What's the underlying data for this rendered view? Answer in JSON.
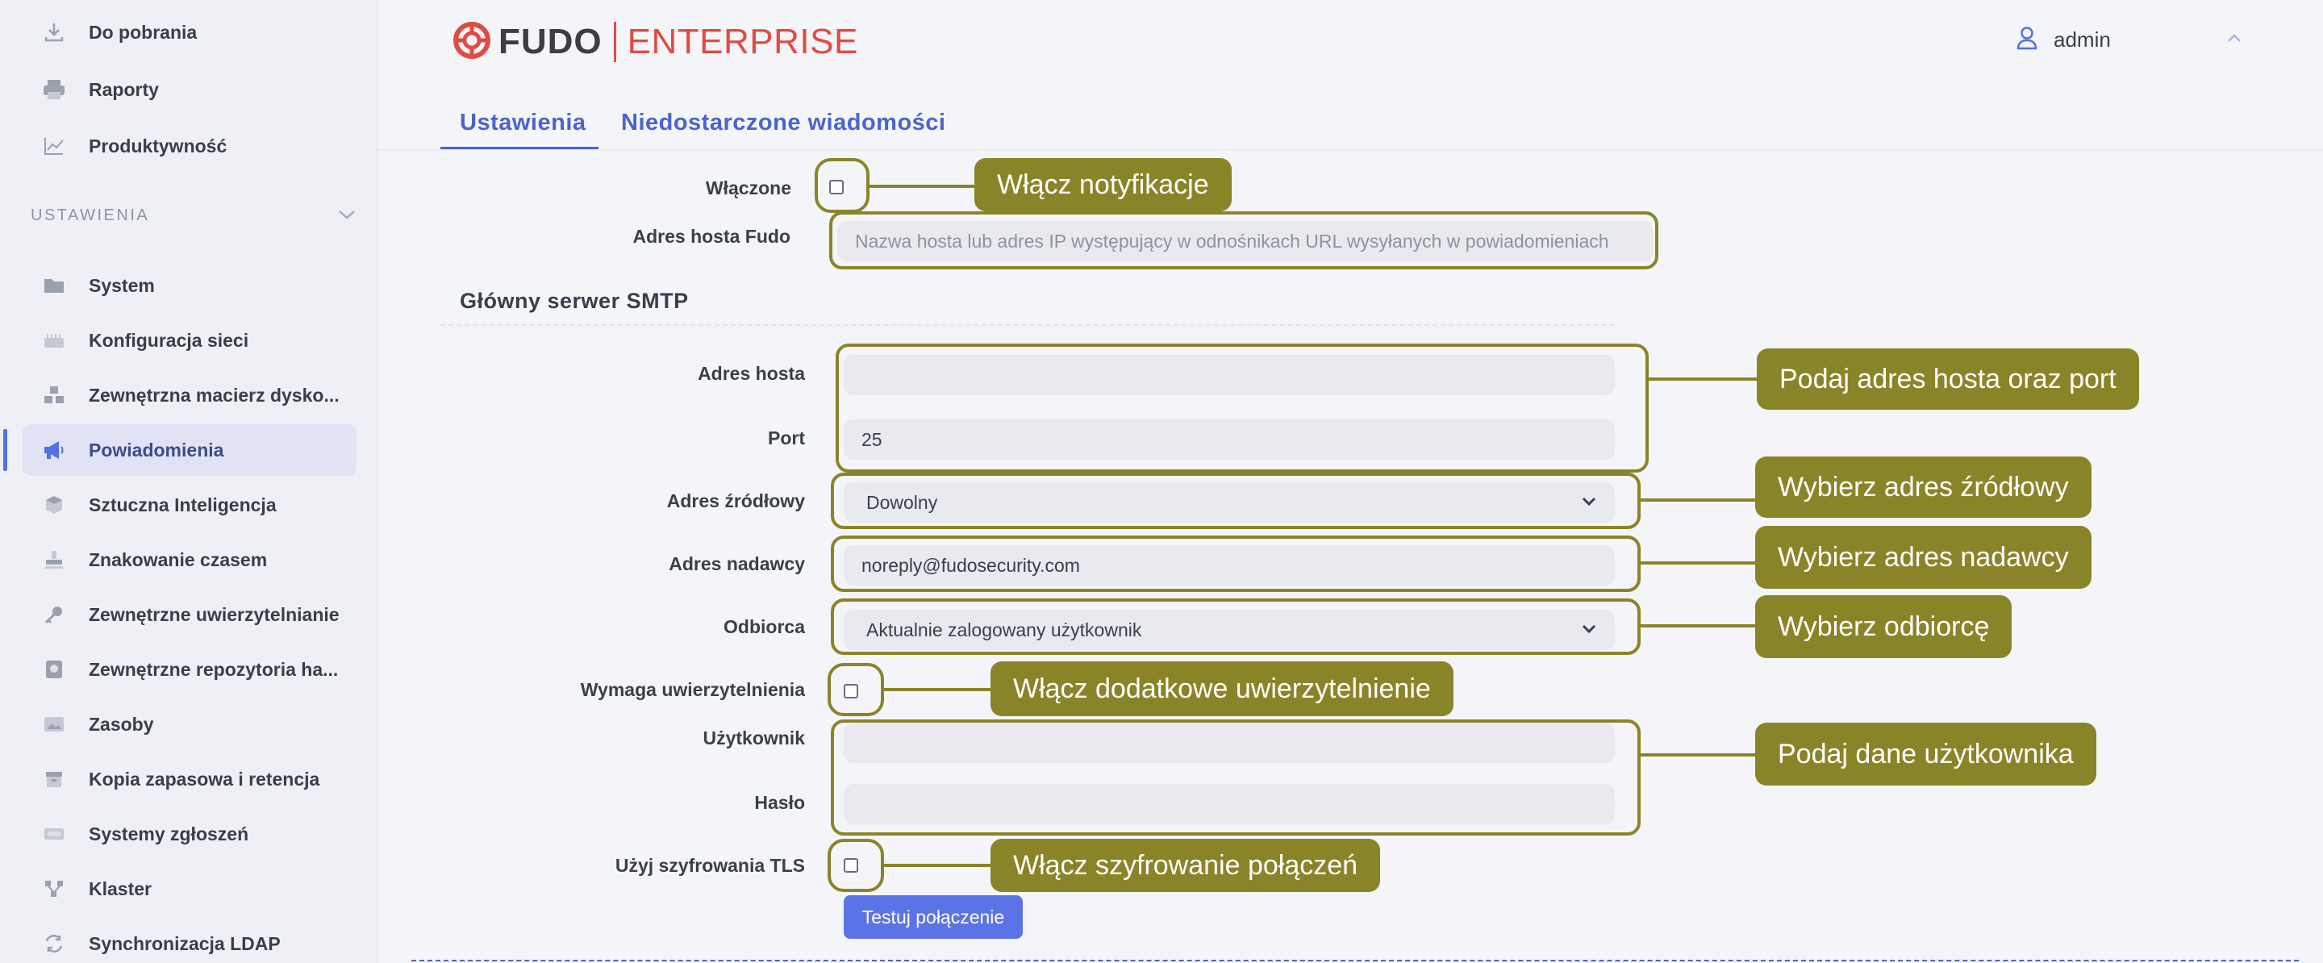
{
  "sidebar": {
    "items_top": [
      {
        "label": "Do pobrania",
        "icon": "download-icon"
      },
      {
        "label": "Raporty",
        "icon": "printer-icon"
      },
      {
        "label": "Produktywność",
        "icon": "chart-line-icon"
      }
    ],
    "section_label": "USTAWIENIA",
    "items": [
      {
        "label": "System",
        "icon": "folder-icon"
      },
      {
        "label": "Konfiguracja sieci",
        "icon": "network-icon"
      },
      {
        "label": "Zewnętrzna macierz dysko...",
        "icon": "storage-icon"
      },
      {
        "label": "Powiadomienia",
        "icon": "megaphone-icon",
        "active": true
      },
      {
        "label": "Sztuczna Inteligencja",
        "icon": "ai-cube-icon"
      },
      {
        "label": "Znakowanie czasem",
        "icon": "stamp-icon"
      },
      {
        "label": "Zewnętrzne uwierzytelnianie",
        "icon": "key-icon"
      },
      {
        "label": "Zewnętrzne repozytoria ha...",
        "icon": "vault-icon"
      },
      {
        "label": "Zasoby",
        "icon": "image-icon"
      },
      {
        "label": "Kopia zapasowa i retencja",
        "icon": "archive-icon"
      },
      {
        "label": "Systemy zgłoszeń",
        "icon": "ticket-icon"
      },
      {
        "label": "Klaster",
        "icon": "cluster-icon"
      },
      {
        "label": "Synchronizacja LDAP",
        "icon": "sync-icon"
      }
    ]
  },
  "header": {
    "logo_fudo": "FUDO",
    "logo_enterprise": "ENTERPRISE",
    "user_name": "admin"
  },
  "tabs": [
    {
      "label": "Ustawienia",
      "active": true
    },
    {
      "label": "Niedostarczone wiadomości",
      "active": false
    }
  ],
  "form": {
    "enabled_label": "Włączone",
    "fudo_host_label": "Adres hosta Fudo",
    "fudo_host_placeholder": "Nazwa hosta lub adres IP występujący w odnośnikach URL wysyłanych w powiadomieniach",
    "smtp_section": "Główny serwer SMTP",
    "host_label": "Adres hosta",
    "host_value": "",
    "port_label": "Port",
    "port_value": "25",
    "source_label": "Adres źródłowy",
    "source_value": "Dowolny",
    "sender_label": "Adres nadawcy",
    "sender_value": "noreply@fudosecurity.com",
    "recipient_label": "Odbiorca",
    "recipient_value": "Aktualnie zalogowany użytkownik",
    "auth_label": "Wymaga uwierzytelnienia",
    "user_label": "Użytkownik",
    "user_value": "",
    "password_label": "Hasło",
    "password_value": "",
    "tls_label": "Użyj szyfrowania TLS",
    "test_button": "Testuj połączenie"
  },
  "callouts": {
    "enable": "Włącz notyfikacje",
    "host_port": "Podaj adres hosta oraz port",
    "source": "Wybierz adres źródłowy",
    "sender": "Wybierz adres nadawcy",
    "recipient": "Wybierz odbiorcę",
    "auth": "Włącz dodatkowe uwierzytelnienie",
    "user": "Podaj dane użytkownika",
    "tls": "Włącz szyfrowanie połączeń"
  },
  "colors": {
    "accent": "#4a63cf",
    "annotation": "#8a8429",
    "brand_red": "#e04b44",
    "button": "#5a74e8"
  }
}
